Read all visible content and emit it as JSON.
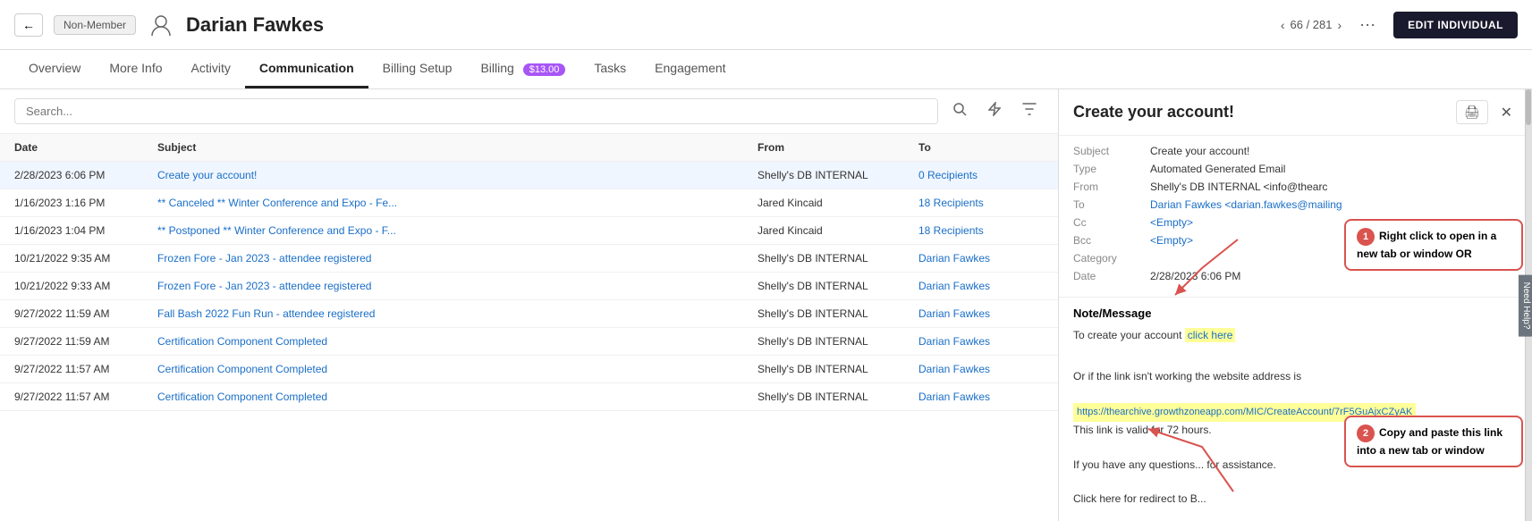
{
  "header": {
    "back_label": "←",
    "member_badge": "Non-Member",
    "person_name": "Darian Fawkes",
    "page_nav": "66 / 281",
    "more_label": "···",
    "edit_label": "EDIT INDIVIDUAL"
  },
  "tabs": [
    {
      "id": "overview",
      "label": "Overview",
      "active": false
    },
    {
      "id": "more-info",
      "label": "More Info",
      "active": false
    },
    {
      "id": "activity",
      "label": "Activity",
      "active": false
    },
    {
      "id": "communication",
      "label": "Communication",
      "active": true
    },
    {
      "id": "billing-setup",
      "label": "Billing Setup",
      "active": false
    },
    {
      "id": "billing",
      "label": "Billing",
      "active": false,
      "badge": "$13.00"
    },
    {
      "id": "tasks",
      "label": "Tasks",
      "active": false
    },
    {
      "id": "engagement",
      "label": "Engagement",
      "active": false
    }
  ],
  "search": {
    "placeholder": "Search..."
  },
  "table": {
    "headers": [
      "Date",
      "Subject",
      "From",
      "To"
    ],
    "rows": [
      {
        "date": "2/28/2023 6:06 PM",
        "subject": "Create your account!",
        "from": "Shelly's DB INTERNAL",
        "to": "0 Recipients",
        "selected": true
      },
      {
        "date": "1/16/2023 1:16 PM",
        "subject": "** Canceled ** Winter Conference and Expo - Fe...",
        "from": "Jared Kincaid",
        "to": "18 Recipients",
        "selected": false
      },
      {
        "date": "1/16/2023 1:04 PM",
        "subject": "** Postponed ** Winter Conference and Expo - F...",
        "from": "Jared Kincaid",
        "to": "18 Recipients",
        "selected": false
      },
      {
        "date": "10/21/2022 9:35 AM",
        "subject": "Frozen Fore - Jan 2023 - attendee registered",
        "from": "Shelly's DB INTERNAL",
        "to": "Darian Fawkes",
        "selected": false
      },
      {
        "date": "10/21/2022 9:33 AM",
        "subject": "Frozen Fore - Jan 2023 - attendee registered",
        "from": "Shelly's DB INTERNAL",
        "to": "Darian Fawkes",
        "selected": false
      },
      {
        "date": "9/27/2022 11:59 AM",
        "subject": "Fall Bash 2022 Fun Run - attendee registered",
        "from": "Shelly's DB INTERNAL",
        "to": "Darian Fawkes",
        "selected": false
      },
      {
        "date": "9/27/2022 11:59 AM",
        "subject": "Certification Component Completed",
        "from": "Shelly's DB INTERNAL",
        "to": "Darian Fawkes",
        "selected": false
      },
      {
        "date": "9/27/2022 11:57 AM",
        "subject": "Certification Component Completed",
        "from": "Shelly's DB INTERNAL",
        "to": "Darian Fawkes",
        "selected": false
      },
      {
        "date": "9/27/2022 11:57 AM",
        "subject": "Certification Component Completed",
        "from": "Shelly's DB INTERNAL",
        "to": "Darian Fawkes",
        "selected": false
      }
    ]
  },
  "panel": {
    "title": "Create your account!",
    "print_label": "🖨",
    "close_label": "✕",
    "fields": {
      "subject_label": "Subject",
      "subject_value": "Create your account!",
      "type_label": "Type",
      "type_value": "Automated Generated Email",
      "from_label": "From",
      "from_value": "Shelly's DB INTERNAL <info@thearc",
      "to_label": "To",
      "to_value": "Darian Fawkes <darian.fawkes@mailing",
      "cc_label": "Cc",
      "cc_value": "<Empty>",
      "bcc_label": "Bcc",
      "bcc_value": "<Empty>",
      "category_label": "Category",
      "category_value": "",
      "date_label": "Date",
      "date_value": "2/28/2023 6:06 PM"
    },
    "note_title": "Note/Message",
    "note_content": "To create your account ",
    "note_link": "click here",
    "note_after_link": "\n\nOr if the link isn't working the website address is",
    "note_url": "https://thearchive.growthzoneapp.com/MIC/CreateAccount/7rF5GuAjxCZyAK",
    "note_validity": "This link is valid for 72 hours.",
    "note_questions": "\n\nIf you have any questions... for assistance.",
    "note_redirect": "\n\nClick here for redirect to B..."
  },
  "annotations": {
    "callout1_text": "Right click to open in a new tab or window OR",
    "callout2_text": "Copy and paste this link into a new tab or window"
  },
  "help_tab": "Need Help?"
}
